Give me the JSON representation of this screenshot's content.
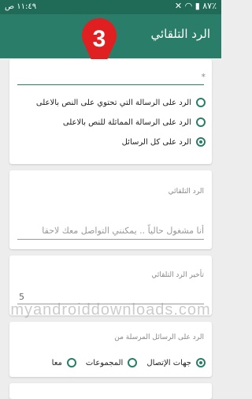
{
  "status_bar": {
    "time": "١١:٤٩ ص",
    "battery": "٨٧٪"
  },
  "app_bar": {
    "title": "الرد التلقائي"
  },
  "step_marker": "3",
  "reply_to": {
    "required_mark": "*",
    "options": [
      {
        "label": "الرد على الرسالة التي تحتوي على النص بالاعلى",
        "checked": false
      },
      {
        "label": "الرد على الرسالة المماثلة للنص بالاعلى",
        "checked": false
      },
      {
        "label": "الرد على كل الرسائل",
        "checked": true
      }
    ]
  },
  "auto_reply": {
    "label": "الرد التلقائي",
    "value": "أنا مشغول حالياً .. يمكنني التواصل معك لاحقا"
  },
  "delay": {
    "label": "تأخير الرد التلقائي",
    "value": "5"
  },
  "senders": {
    "label": "الرد على الرسائل المرسلة من",
    "options": [
      {
        "label": "جهات الإتصال",
        "checked": true
      },
      {
        "label": "المجموعات",
        "checked": false
      },
      {
        "label": "معا",
        "checked": false
      }
    ]
  },
  "watermark": "myandroiddownloads.com",
  "colors": {
    "primary": "#2a7d68",
    "status_bar": "#1f6b58",
    "marker": "#e02020"
  }
}
